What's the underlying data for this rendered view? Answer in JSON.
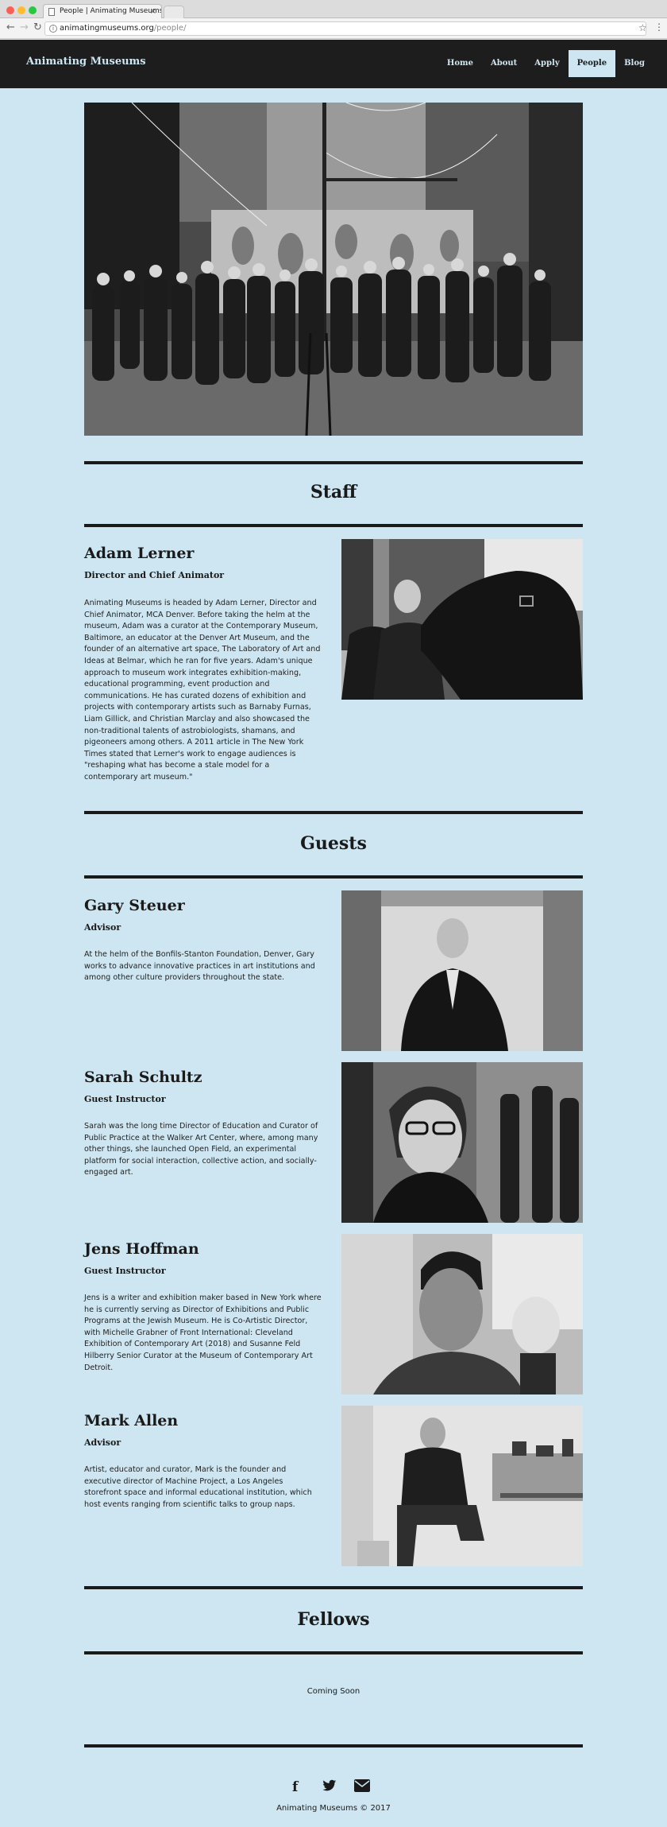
{
  "browser": {
    "tab_title": "People | Animating Museums",
    "tab_close": "×",
    "url_host": "animatingmuseums.org",
    "url_path": "/people/",
    "back_icon": "←",
    "forward_icon": "→",
    "reload_icon": "↻",
    "star_icon": "☆",
    "menu_icon": "⋮",
    "info_icon": "i"
  },
  "nav": {
    "logo": "Animating Museums",
    "items": [
      {
        "label": "Home"
      },
      {
        "label": "About"
      },
      {
        "label": "Apply"
      },
      {
        "label": "People",
        "active": true
      },
      {
        "label": "Blog"
      }
    ]
  },
  "colors": {
    "background": "#cde6f1",
    "nav_background": "#1d1d1d",
    "text": "#1a1a1a"
  },
  "sections": {
    "staff": "Staff",
    "guests": "Guests",
    "fellows": "Fellows"
  },
  "staff": [
    {
      "name": "Adam Lerner",
      "role": "Director and Chief Animator",
      "bio": "Animating Museums is headed by Adam Lerner, Director and Chief Animator, MCA Denver. Before taking the helm at the museum, Adam was a curator at the Contemporary Museum, Baltimore, an educator at the Denver Art Museum, and the founder of an alternative art space, The Laboratory of Art and Ideas at Belmar, which he ran for five years. Adam's unique approach to museum work integrates exhibition-making, educational programming, event production and communications. He has curated dozens of exhibition and projects with contemporary artists such as Barnaby Furnas, Liam Gillick, and Christian Marclay and also showcased the non-traditional talents of astrobiologists, shamans, and pigeoneers among others. A 2011 article in The New York Times stated that Lerner's work to engage audiences is \"reshaping what has become a stale model for a contemporary art museum.\""
    }
  ],
  "guests": [
    {
      "name": "Gary Steuer",
      "role": "Advisor",
      "bio": "At the helm of the Bonfils-Stanton Foundation, Denver, Gary works to advance innovative practices in art institutions and among other culture providers throughout the state."
    },
    {
      "name": "Sarah Schultz",
      "role": "Guest Instructor",
      "bio": "Sarah was the long time Director of Education and Curator of Public Practice at the Walker Art Center, where, among many other things, she launched Open Field, an experimental platform for social interaction, collective action, and socially-engaged art."
    },
    {
      "name": "Jens Hoffman",
      "role": "Guest Instructor",
      "bio": "Jens is a writer and exhibition maker based in New York where he is currently serving as Director of Exhibitions and Public Programs at the Jewish Museum. He is Co-Artistic Director, with Michelle Grabner of Front International: Cleveland Exhibition of Contemporary Art (2018) and Susanne Feld Hilberry Senior Curator at the Museum of Contemporary Art Detroit."
    },
    {
      "name": "Mark Allen",
      "role": "Advisor",
      "bio": "Artist, educator and curator, Mark is the founder and executive director of Machine Project, a Los Angeles storefront space and informal educational institution, which host events ranging from scientific talks to group naps."
    }
  ],
  "fellows": {
    "status": "Coming Soon"
  },
  "footer": {
    "icons": [
      "facebook-icon",
      "twitter-icon",
      "email-icon"
    ],
    "facebook_glyph": "f",
    "twitter_glyph": "🐦",
    "email_glyph": "✉",
    "copyright": "Animating Museums © 2017"
  }
}
